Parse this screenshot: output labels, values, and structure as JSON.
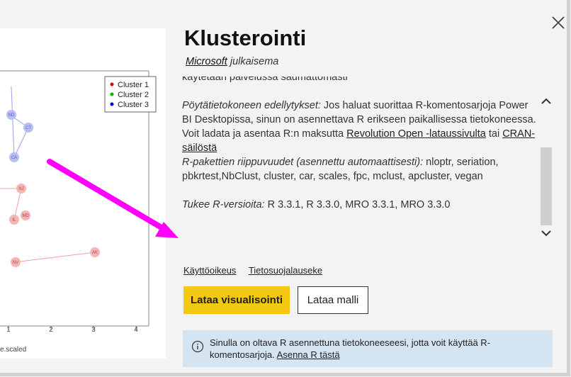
{
  "dialog": {
    "title": "Klusterointi",
    "publisher_name": "Microsoft",
    "publisher_suffix": " julkaisema"
  },
  "preview": {
    "legend": [
      "Cluster 1",
      "Cluster 2",
      "Cluster 3"
    ],
    "legend_colors": [
      "#e00000",
      "#00bb00",
      "#0000ee"
    ],
    "points": [
      "ND",
      "CT",
      "CA",
      "NJ",
      "IL",
      "MD",
      "NV",
      "AK"
    ],
    "x_ticks": [
      "1",
      "2",
      "3",
      "4"
    ],
    "x_label": "e.scaled"
  },
  "description": {
    "line_partial": "käytetään palvelussa saumattomasti",
    "desktop_label": "Pöytätietokoneen edellytykset:",
    "desktop_text": " Jos haluat suorittaa R-komentosarjoja Power BI Desktopissa, sinun on asennettava R erikseen paikallisessa tietokoneessa.",
    "download_text": "Voit ladata ja asentaa R:n maksutta ",
    "download_link": "Revolution Open -lataussivulta",
    "or_text": " tai ",
    "cran_link": "CRAN-säilöstä",
    "packages_label": "R-pakettien riippuvuudet (asennettu automaattisesti):",
    "packages_text": " nloptr, seriation, pbkrtest,NbClust, cluster, car, scales, fpc, mclust, apcluster, vegan",
    "versions_label": "Tukee R-versioita:",
    "versions_text": " R 3.3.1, R 3.3.0, MRO 3.3.1, MRO 3.3.0"
  },
  "links": {
    "terms": "Käyttöoikeus",
    "privacy": "Tietosuojalauseke"
  },
  "buttons": {
    "download_visual": "Lataa visualisointi",
    "download_sample": "Lataa malli"
  },
  "info": {
    "text": "Sinulla on oltava R asennettuna tietokoneeseesi, jotta voit käyttää R-komentosarjoja. ",
    "link": "Asenna R tästä"
  },
  "colors": {
    "primary_button": "#f2c811",
    "info_background": "#d5e4f1",
    "arrow": "#ff00ff"
  }
}
